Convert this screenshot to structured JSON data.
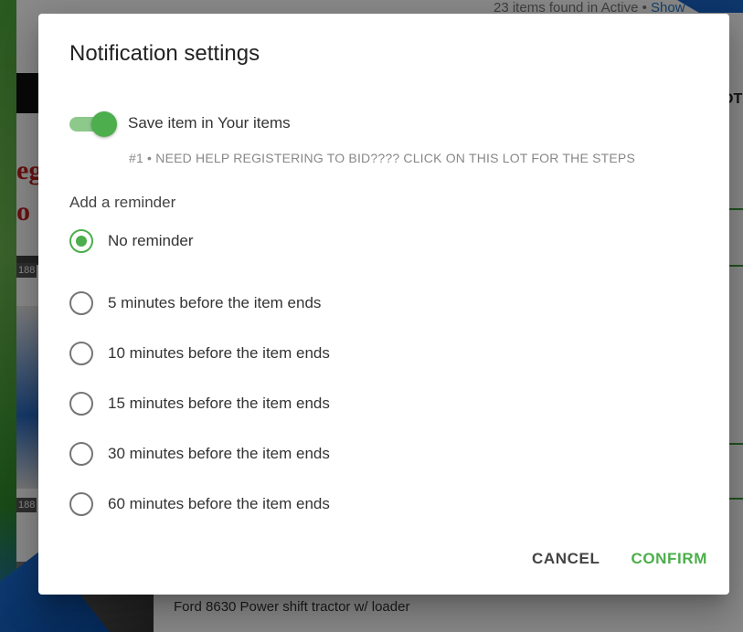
{
  "background": {
    "top_text": "23 items found in Active • ",
    "top_link": "Show",
    "lot_text_fragment": "OT",
    "red_text_1": "eg",
    "red_text_2": "o",
    "small_num_1": "188",
    "small_num_2": "188",
    "bottom_caption": "Ford 8630 Power shift tractor w/ loader"
  },
  "dialog": {
    "title": "Notification settings",
    "save_toggle": {
      "label": "Save item in Your items",
      "checked": true
    },
    "lot_subtitle": "#1 • NEED HELP REGISTERING TO BID???? CLICK ON THIS LOT FOR THE STEPS",
    "reminder_heading": "Add a reminder",
    "reminder_options": [
      {
        "label": "No reminder",
        "selected": true
      },
      {
        "label": "5 minutes before the item ends",
        "selected": false
      },
      {
        "label": "10 minutes before the item ends",
        "selected": false
      },
      {
        "label": "15 minutes before the item ends",
        "selected": false
      },
      {
        "label": "30 minutes before the item ends",
        "selected": false
      },
      {
        "label": "60 minutes before the item ends",
        "selected": false
      }
    ],
    "cancel_label": "CANCEL",
    "confirm_label": "CONFIRM"
  },
  "colors": {
    "accent": "#4cae4c",
    "toggle_track": "#8cc98a",
    "overlay": "rgba(0,0,0,0.46)"
  }
}
